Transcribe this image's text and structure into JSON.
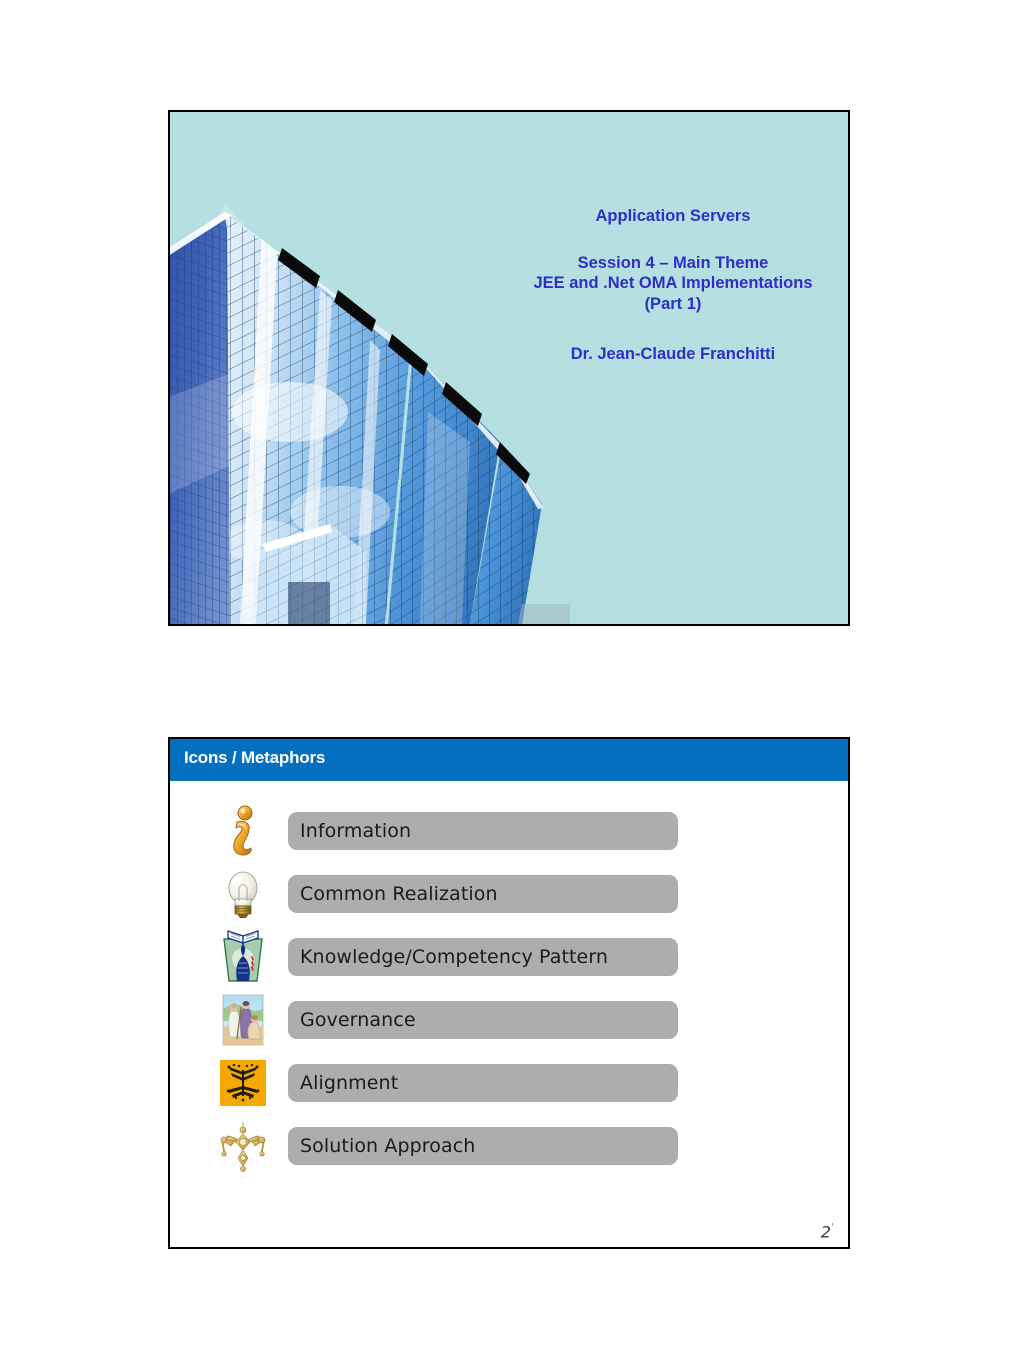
{
  "slide1": {
    "name": "title-slide",
    "background_color": "#b6dfe2",
    "text_color": "#2f2fc8",
    "heading": "Application Servers",
    "session_lines": [
      "Session 4 – Main Theme",
      "JEE and .Net OMA Implementations",
      "(Part 1)"
    ],
    "author": "Dr. Jean-Claude Franchitti",
    "image": {
      "icon_name": "glass-skyscraper-photo",
      "description": "Glass skyscraper photographed from below"
    }
  },
  "slide2": {
    "name": "icons-metaphors-slide",
    "header": {
      "title": "Icons / Metaphors",
      "background_color": "#0570bf",
      "text_color": "#ffffff"
    },
    "pill_color": "#adadad",
    "items": [
      {
        "label": "Information",
        "icon": "information-i-icon"
      },
      {
        "label": "Common Realization",
        "icon": "lightbulb-icon"
      },
      {
        "label": "Knowledge/Competency Pattern",
        "icon": "keystone-head-book-icon"
      },
      {
        "label": "Governance",
        "icon": "robed-figures-icon"
      },
      {
        "label": "Alignment",
        "icon": "amber-square-tree-icon"
      },
      {
        "label": "Solution Approach",
        "icon": "gold-ornament-icon"
      }
    ],
    "page_number": "2",
    "page_number_accent": "'"
  }
}
